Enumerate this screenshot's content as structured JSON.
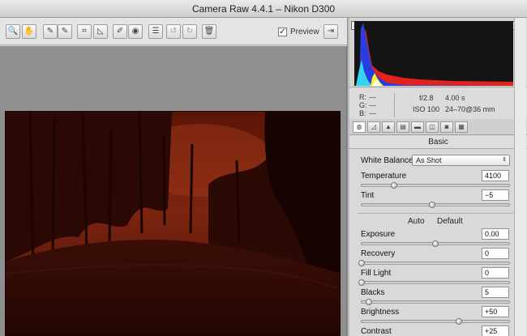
{
  "window": {
    "title": "Camera Raw 4.4.1  –  Nikon D300"
  },
  "toolbar": {
    "tools": [
      {
        "name": "zoom-tool",
        "glyph": "🔍"
      },
      {
        "name": "hand-tool",
        "glyph": "✋"
      },
      {
        "name": "white-balance-tool",
        "glyph": "✎"
      },
      {
        "name": "color-sampler-tool",
        "glyph": "✎"
      },
      {
        "name": "crop-tool",
        "glyph": "⌗"
      },
      {
        "name": "straighten-tool",
        "glyph": "◺"
      },
      {
        "name": "retouch-tool",
        "glyph": "✐"
      },
      {
        "name": "red-eye-tool",
        "glyph": "◉"
      },
      {
        "name": "preferences-button",
        "glyph": "☰"
      },
      {
        "name": "rotate-left-button",
        "glyph": "↺"
      },
      {
        "name": "rotate-right-button",
        "glyph": "↻"
      },
      {
        "name": "trash-button",
        "glyph": "🗑"
      }
    ],
    "preview_checked": "✓",
    "preview_label": "Preview",
    "fullscreen_glyph": "⇥"
  },
  "histogram": {
    "shadow_clip_glyph": "▲",
    "highlight_clip_glyph": "▲"
  },
  "info": {
    "r_label": "R:",
    "r_value": "---",
    "g_label": "G:",
    "g_value": "---",
    "b_label": "B:",
    "b_value": "---",
    "aperture": "f/2.8",
    "shutter": "4.00 s",
    "iso": "ISO 100",
    "lens": "24–70@36 mm"
  },
  "tabs": [
    {
      "name": "tab-basic",
      "glyph": "◍",
      "active": true
    },
    {
      "name": "tab-tone-curve",
      "glyph": "◿"
    },
    {
      "name": "tab-detail",
      "glyph": "▲"
    },
    {
      "name": "tab-hsl",
      "glyph": "▤"
    },
    {
      "name": "tab-split-toning",
      "glyph": "▬"
    },
    {
      "name": "tab-lens-corrections",
      "glyph": "◫"
    },
    {
      "name": "tab-camera-calibration",
      "glyph": "◙"
    },
    {
      "name": "tab-presets",
      "glyph": "▦"
    }
  ],
  "basic": {
    "title": "Basic",
    "white_balance_label": "White Balance:",
    "white_balance_value": "As Shot",
    "auto_label": "Auto",
    "default_label": "Default",
    "sliders": [
      {
        "id": "temperature",
        "label": "Temperature",
        "value": "4100",
        "position": 0.22
      },
      {
        "id": "tint",
        "label": "Tint",
        "value": "−5",
        "position": 0.48
      },
      {
        "id": "exposure",
        "label": "Exposure",
        "value": "0.00",
        "position": 0.5
      },
      {
        "id": "recovery",
        "label": "Recovery",
        "value": "0",
        "position": 0.0
      },
      {
        "id": "fill-light",
        "label": "Fill Light",
        "value": "0",
        "position": 0.0
      },
      {
        "id": "blacks",
        "label": "Blacks",
        "value": "5",
        "position": 0.05
      },
      {
        "id": "brightness",
        "label": "Brightness",
        "value": "+50",
        "position": 0.66
      },
      {
        "id": "contrast",
        "label": "Contrast",
        "value": "+25",
        "position": 0.6
      }
    ]
  },
  "colors": {
    "photo_bg": "#2c0804",
    "histogram_bg": "#141414",
    "histogram_red": "#e3231b",
    "histogram_blue": "#2a3de0",
    "histogram_cyan": "#32d6f0",
    "histogram_yellow": "#f5ef2a"
  }
}
